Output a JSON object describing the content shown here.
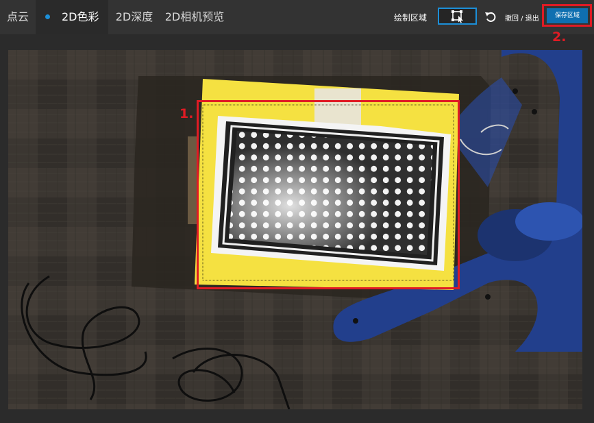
{
  "tabs": [
    {
      "label": "点云",
      "active": false
    },
    {
      "label": "2D色彩",
      "active": true
    },
    {
      "label": "2D深度",
      "active": false
    },
    {
      "label": "2D相机预览",
      "active": false
    }
  ],
  "toolbar": {
    "draw_region_label": "绘制区域",
    "draw_region_icon": "region-select-icon",
    "undo_icon": "undo-icon",
    "undo_exit_label": "撤回 / 退出",
    "save_region_label": "保存区域"
  },
  "annotations": {
    "step1": "1.",
    "step2": "2."
  },
  "colors": {
    "accent": "#1c8fd8",
    "save_button": "#0f6fb0",
    "annotation": "#e01b24",
    "roi_fill": "#f5e141"
  }
}
